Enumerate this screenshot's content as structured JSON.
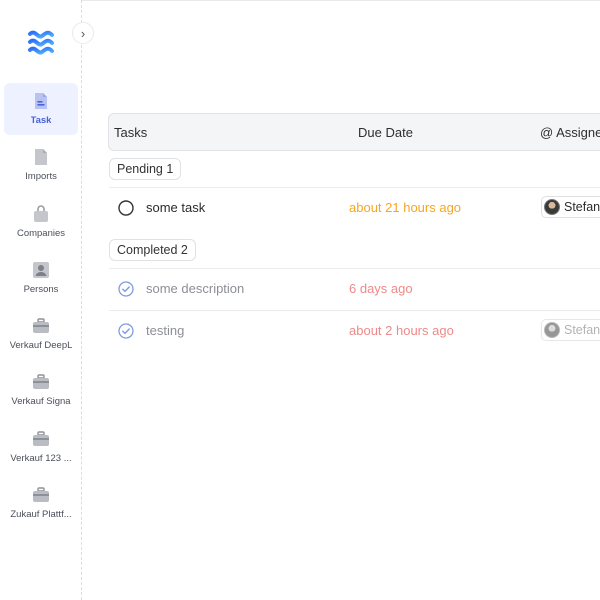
{
  "sidebar": {
    "items": [
      {
        "label": "Task",
        "active": true,
        "icon": "task-doc-icon"
      },
      {
        "label": "Imports",
        "active": false,
        "icon": "file-icon"
      },
      {
        "label": "Companies",
        "active": false,
        "icon": "bag-icon"
      },
      {
        "label": "Persons",
        "active": false,
        "icon": "person-icon"
      },
      {
        "label": "Verkauf DeepL",
        "active": false,
        "icon": "briefcase-icon"
      },
      {
        "label": "Verkauf Signa",
        "active": false,
        "icon": "briefcase-icon"
      },
      {
        "label": "Verkauf 123 ...",
        "active": false,
        "icon": "briefcase-icon"
      },
      {
        "label": "Zukauf Plattf...",
        "active": false,
        "icon": "briefcase-icon"
      }
    ],
    "collapse_icon": "chevron-right-icon"
  },
  "table": {
    "columns": {
      "tasks": "Tasks",
      "due_date": "Due Date",
      "assignee": "@ Assignee"
    },
    "groups": {
      "pending": {
        "label": "Pending 1",
        "rows": [
          {
            "title": "some task",
            "due": "about 21 hours ago",
            "assignee": "Stefan",
            "status": "open"
          }
        ]
      },
      "completed": {
        "label": "Completed 2",
        "rows": [
          {
            "title": "some description",
            "due": "6 days ago",
            "assignee": "",
            "status": "done"
          },
          {
            "title": "testing",
            "due": "about 2 hours ago",
            "assignee": "Stefan",
            "status": "done"
          }
        ]
      }
    }
  },
  "colors": {
    "accent": "#4a63d8",
    "due_pending": "#f5a623",
    "due_overdue": "#ef8a8a",
    "check_done": "#7f9be0"
  }
}
